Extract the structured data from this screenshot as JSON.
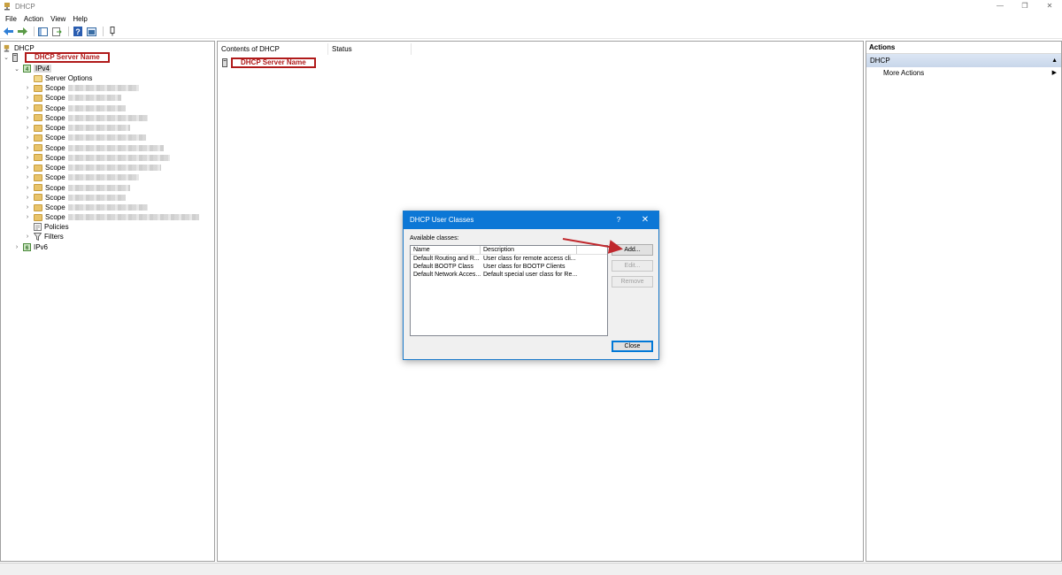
{
  "window": {
    "title": "DHCP",
    "controls": [
      "—",
      "❐",
      "✕"
    ]
  },
  "menu": [
    "File",
    "Action",
    "View",
    "Help"
  ],
  "tree": {
    "root": "DHCP",
    "server": "DHCP Server Name",
    "ipv4": "IPv4",
    "server_options": "Server Options",
    "scopes": [
      "Scope",
      "Scope",
      "Scope",
      "Scope",
      "Scope",
      "Scope",
      "Scope",
      "Scope",
      "Scope",
      "Scope",
      "Scope",
      "Scope",
      "Scope",
      "Scope"
    ],
    "policies": "Policies",
    "filters": "Filters",
    "ipv6": "IPv6"
  },
  "content": {
    "col_contents": "Contents of DHCP",
    "col_status": "Status",
    "item": "DHCP Server Name"
  },
  "actions": {
    "title": "Actions",
    "section": "DHCP",
    "more": "More Actions"
  },
  "dialog": {
    "title": "DHCP User Classes",
    "help": "?",
    "close_glyph": "✕",
    "available_label": "Available classes:",
    "columns": [
      "Name",
      "Description"
    ],
    "rows": [
      {
        "name": "Default Routing and R...",
        "desc": "User class for remote access cli..."
      },
      {
        "name": "Default BOOTP Class",
        "desc": "User class for BOOTP Clients"
      },
      {
        "name": "Default Network Acces...",
        "desc": "Default special user class for Re..."
      }
    ],
    "buttons": {
      "add": "Add...",
      "edit": "Edit...",
      "remove": "Remove",
      "close": "Close"
    }
  },
  "colors": {
    "annotation_red": "#b01a1a",
    "dialog_title_blue": "#0c77d6"
  }
}
